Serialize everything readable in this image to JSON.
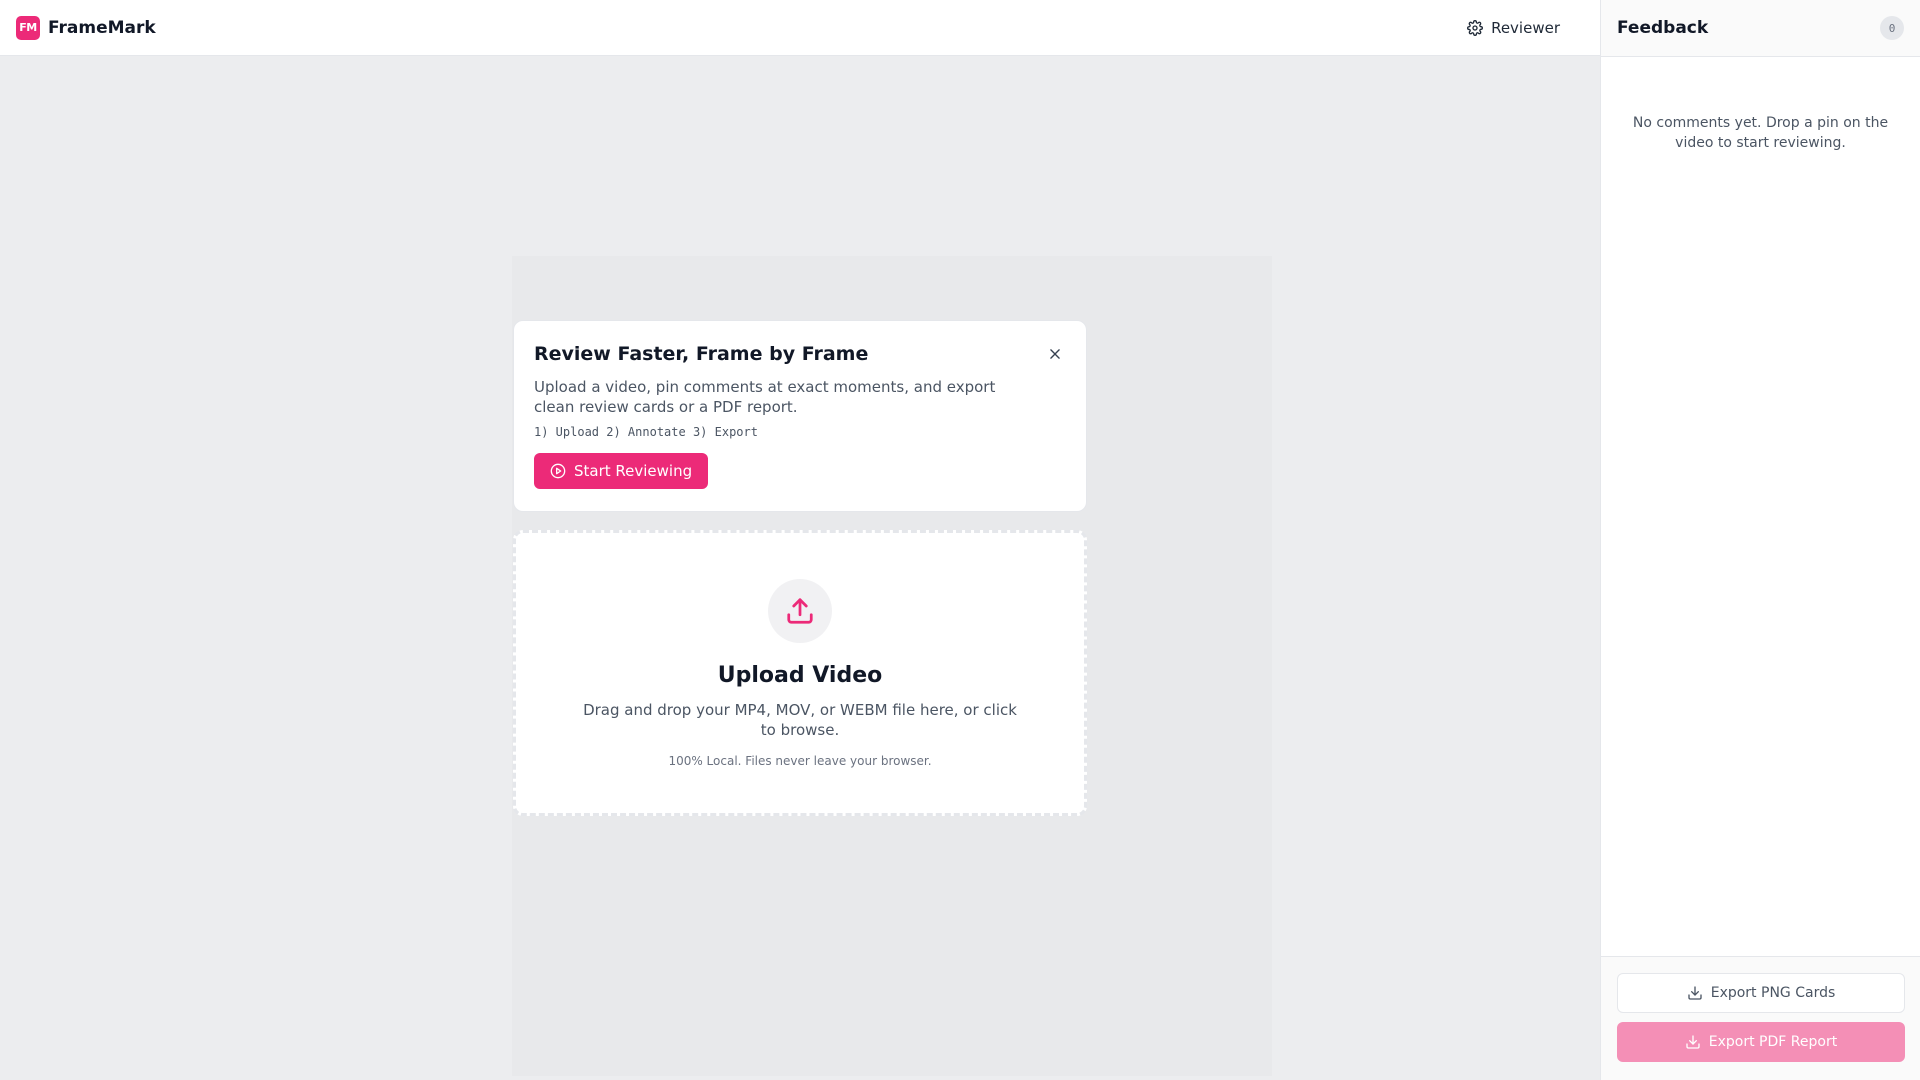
{
  "app": {
    "logo_text": "FM",
    "name": "FrameMark",
    "accent_color": "#ec2a78"
  },
  "header": {
    "reviewer_label": "Reviewer",
    "reviewer_icon": "gear-icon"
  },
  "welcome": {
    "title": "Review Faster, Frame by Frame",
    "description": "Upload a video, pin comments at exact moments, and export clean review cards or a PDF report.",
    "steps": "1) Upload 2) Annotate 3) Export",
    "start_label": "Start Reviewing",
    "close_icon": "close-icon"
  },
  "upload": {
    "title": "Upload Video",
    "description": "Drag and drop your MP4, MOV, or WEBM file here, or click to browse.",
    "note": "100% Local. Files never leave your browser.",
    "icon": "upload-icon"
  },
  "feedback": {
    "title": "Feedback",
    "count": "0",
    "empty_message": "No comments yet. Drop a pin on the video to start reviewing.",
    "export_png_label": "Export PNG Cards",
    "export_pdf_label": "Export PDF Report"
  }
}
